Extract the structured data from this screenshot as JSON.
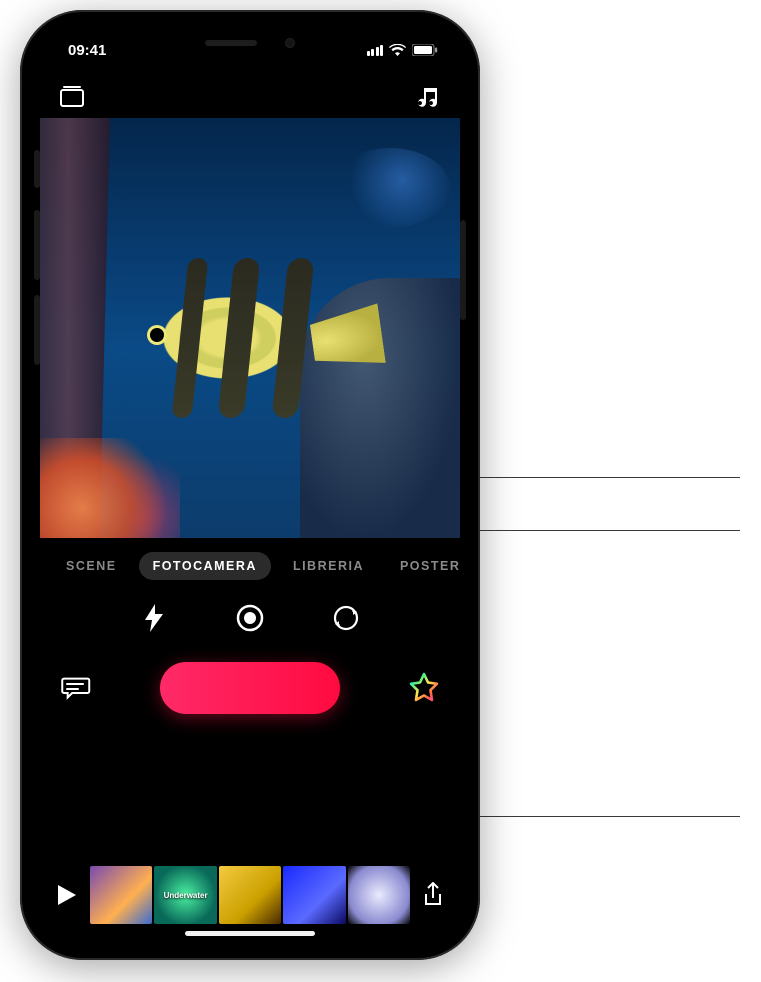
{
  "statusbar": {
    "time": "09:41"
  },
  "modes": {
    "scene": "SCENE",
    "camera": "FOTOCAMERA",
    "library": "LIBRERIA",
    "poster": "POSTER",
    "active": "camera"
  },
  "timeline": {
    "thumb2_label": "Underwater"
  }
}
